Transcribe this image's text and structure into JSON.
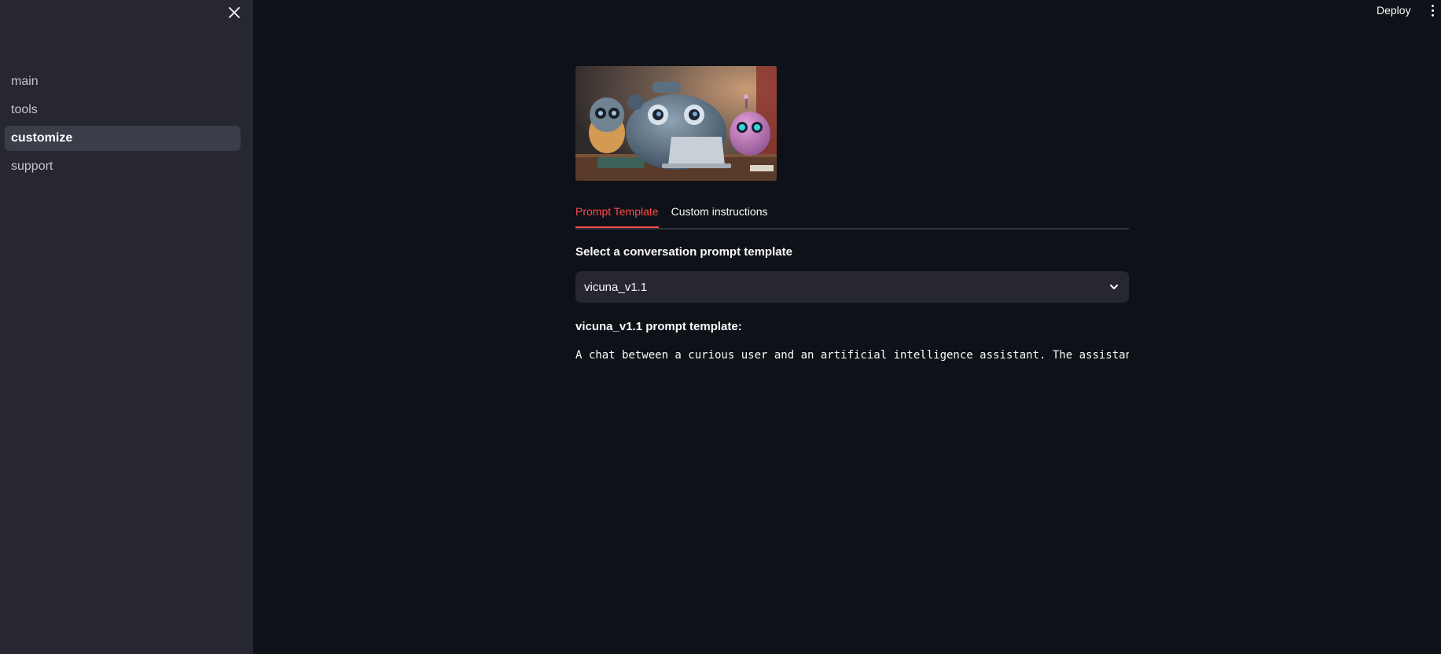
{
  "sidebar": {
    "close_icon": "close-icon",
    "items": [
      {
        "label": "main",
        "active": false
      },
      {
        "label": "tools",
        "active": false
      },
      {
        "label": "customize",
        "active": true
      },
      {
        "label": "support",
        "active": false
      }
    ]
  },
  "topbar": {
    "deploy_label": "Deploy",
    "menu_icon": "more-vertical-icon"
  },
  "main": {
    "hero_image": "robots-at-laptop-illustration",
    "tabs": [
      {
        "label": "Prompt Template",
        "active": true
      },
      {
        "label": "Custom instructions",
        "active": false
      }
    ],
    "select_label": "Select a conversation prompt template",
    "select_value": "vicuna_v1.1",
    "select_icon": "chevron-down-icon",
    "template_title": "vicuna_v1.1 prompt template:",
    "template_text": "A chat between a curious user and an artificial intelligence assistant. The assistant gives helpful, detailed, and polite answers to the user's questions."
  },
  "colors": {
    "background": "#0e1117",
    "sidebar": "#262730",
    "accent": "#ff4b4b",
    "text": "#fafafa"
  }
}
